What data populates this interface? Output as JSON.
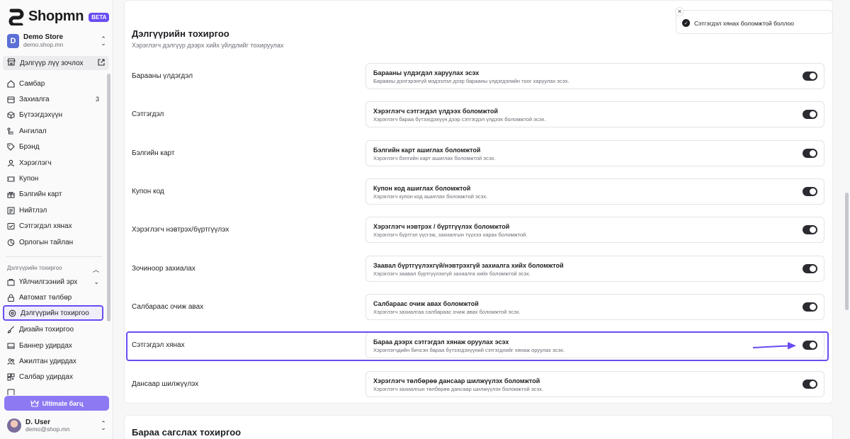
{
  "brand": {
    "name": "Shopmn",
    "badge": "BETA"
  },
  "store": {
    "initial": "D",
    "name": "Demo Store",
    "url": "demo.shop.mn"
  },
  "visit_store": {
    "label": "Дэлгүүр лүү зочлох"
  },
  "nav": {
    "items": [
      {
        "label": "Самбар",
        "icon": "dashboard-icon"
      },
      {
        "label": "Захиалга",
        "icon": "orders-icon",
        "badge": "3"
      },
      {
        "label": "Бүтээгдэхүүн",
        "icon": "box-icon"
      },
      {
        "label": "Ангилал",
        "icon": "category-icon"
      },
      {
        "label": "Брэнд",
        "icon": "tag-icon"
      },
      {
        "label": "Хэрэглэгч",
        "icon": "user-icon"
      },
      {
        "label": "Купон",
        "icon": "coupon-icon"
      },
      {
        "label": "Бэлгийн карт",
        "icon": "gift-icon"
      },
      {
        "label": "Нийтлэл",
        "icon": "article-icon"
      },
      {
        "label": "Сэтгэгдэл хянах",
        "icon": "review-icon"
      },
      {
        "label": "Орлогын тайлан",
        "icon": "report-icon"
      }
    ],
    "group_label": "Дэлгүүрийн тохиргоо",
    "group_items": [
      {
        "label": "Үйлчилгээний эрх",
        "icon": "license-icon",
        "chevron": true
      },
      {
        "label": "Автомат төлбөр",
        "icon": "lock-icon"
      },
      {
        "label": "Дэлгүүрийн тохиргоо",
        "icon": "settings-icon",
        "active": true
      },
      {
        "label": "Дизайн тохиргоо",
        "icon": "brush-icon"
      },
      {
        "label": "Баннер удирдах",
        "icon": "banner-icon"
      },
      {
        "label": "Ажилтан удирдах",
        "icon": "team-icon"
      },
      {
        "label": "Салбар удирдах",
        "icon": "branch-icon"
      },
      {
        "label": "",
        "icon": "more-icon"
      }
    ]
  },
  "upgrade": {
    "label": "Ultimate багц"
  },
  "user": {
    "name": "D. User",
    "email": "demo@shop.mn"
  },
  "section": {
    "title": "Дэлгүүрийн тохиргоо",
    "subtitle": "Хэрэглэгч дэлгүүр дээрх хийх үйлдлийг тохируулах"
  },
  "settings": [
    {
      "label": "Барааны үлдэгдэл",
      "title": "Барааны үлдэгдэл харуулах эсэх",
      "desc": "Барааны дэлгэрэнгүй мэдээлэл дээр барааны үлдэгдэлийн тоог харуулах эсэх.",
      "enabled": true
    },
    {
      "label": "Сэтгэгдэл",
      "title": "Хэрэглэгч сэтгэгдэл үлдээх боломжтой",
      "desc": "Хэрэглэгч бараа бүтээгдэхүүн дээр сэтгэгдэл үлдээх боломжтой эсэх.",
      "enabled": true
    },
    {
      "label": "Бэлгийн карт",
      "title": "Бэлгийн карт ашиглах боломжтой",
      "desc": "Хэрэглэгч бэлгийн карт ашиглах боломжтой эсэх.",
      "enabled": true
    },
    {
      "label": "Купон код",
      "title": "Купон код ашиглах боломжтой",
      "desc": "Хэрэглэгч купон код ашиглах боломжтой эсэх.",
      "enabled": true
    },
    {
      "label": "Хэрэглэгч нэвтрэх/бүртгүүлэх",
      "title": "Хэрэглэгч нэвтрэх / бүртгүүлэх боломжтой",
      "desc": "Хэрэглэгч бүртгэл үүсгэж, захиалгын түүхээ харах боломжтой.",
      "enabled": true
    },
    {
      "label": "Зочиноор захиалах",
      "title": "Заавал бүртгүүлэхгүй/нэвтрэхгүй захиалга хийх боломжтой",
      "desc": "Хэрэглэгч заавал бүртгүүлэхгүй захиалга хийх боломжтой эсэх.",
      "enabled": true
    },
    {
      "label": "Салбараас очиж авах",
      "title": "Салбараас очиж авах боломжтой",
      "desc": "Хэрэглэгч захиалгаа салбараас очиж авах боломжтой эсэх.",
      "enabled": true
    },
    {
      "label": "Сэтгэгдэл хянах",
      "title": "Бараа дээрх сэтгэгдэл хянаж оруулах эсэх",
      "desc": "Хэрэглэгчдийн бичсэн бараа бүтээгдэхүүний сэтгэгдлийг хянаж оруулах эсэх.",
      "enabled": true,
      "highlighted": true
    },
    {
      "label": "Дансаар шилжүүлэх",
      "title": "Хэрэглэгч төлбөрөө дансаар шилжүүлэх боломжтой",
      "desc": "Хэрэглэгч захиалгын төлбөрөө дансаар шилжүүлэх боломжтой эсэх.",
      "enabled": true
    }
  ],
  "next_section": {
    "title": "Бараа сагслах тохиргоо"
  },
  "toast": {
    "message": "Сэтгэгдэл хянах боломжтой боллоо"
  },
  "colors": {
    "accent": "#6a4cf2",
    "toggle_on": "#2b2c31",
    "upgrade": "#8d7af3"
  }
}
